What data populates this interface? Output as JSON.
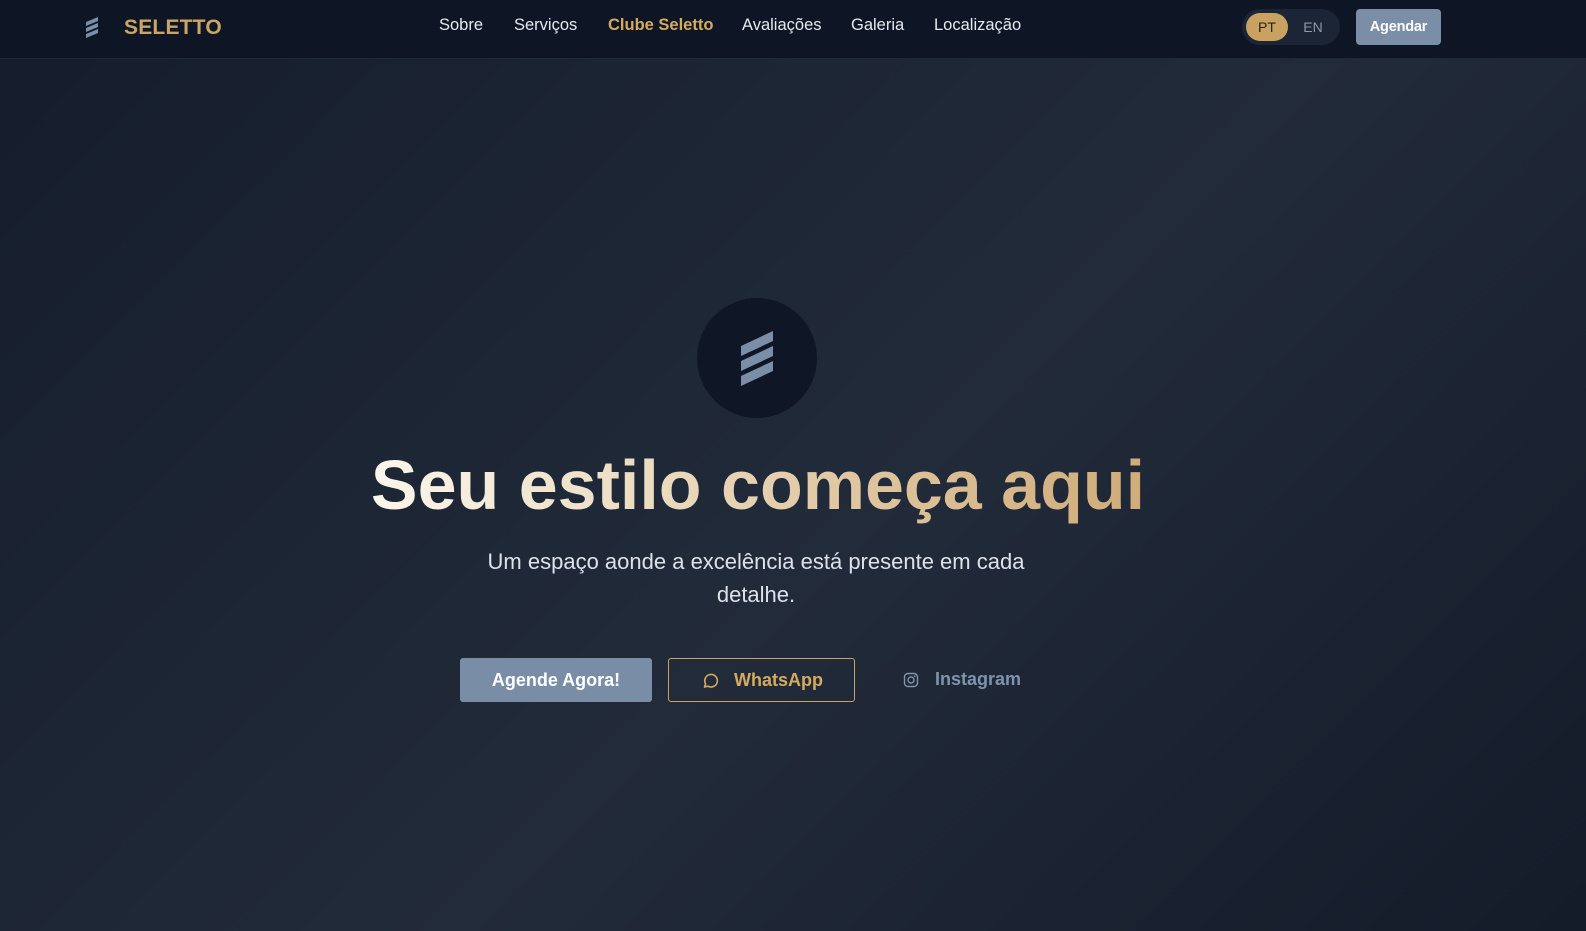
{
  "brand": {
    "name": "SELETTO",
    "logo_icon": "seletto-s-logo-icon",
    "color": "#cba565"
  },
  "nav": {
    "links": [
      {
        "label": "Sobre",
        "active": false
      },
      {
        "label": "Serviços",
        "active": false
      },
      {
        "label": "Clube Seletto",
        "active": true
      },
      {
        "label": "Avaliações",
        "active": false
      },
      {
        "label": "Galeria",
        "active": false
      },
      {
        "label": "Localização",
        "active": false
      }
    ],
    "languages": [
      {
        "label": "PT",
        "selected": true
      },
      {
        "label": "EN",
        "selected": false
      }
    ],
    "cta_label": "Agendar"
  },
  "hero": {
    "logo_icon": "seletto-s-logo-icon",
    "title": "Seu estilo começa aqui",
    "subtitle": "Um espaço aonde a excelência está presente em cada detalhe.",
    "primary_button": "Agende Agora!",
    "whatsapp_button": {
      "label": "WhatsApp",
      "icon": "message-circle-icon"
    },
    "instagram_button": {
      "label": "Instagram",
      "icon": "instagram-icon"
    }
  },
  "colors": {
    "accent_gold": "#d6aa5f",
    "button_slate": "#7a8da7",
    "nav_background": "#0e1626"
  }
}
